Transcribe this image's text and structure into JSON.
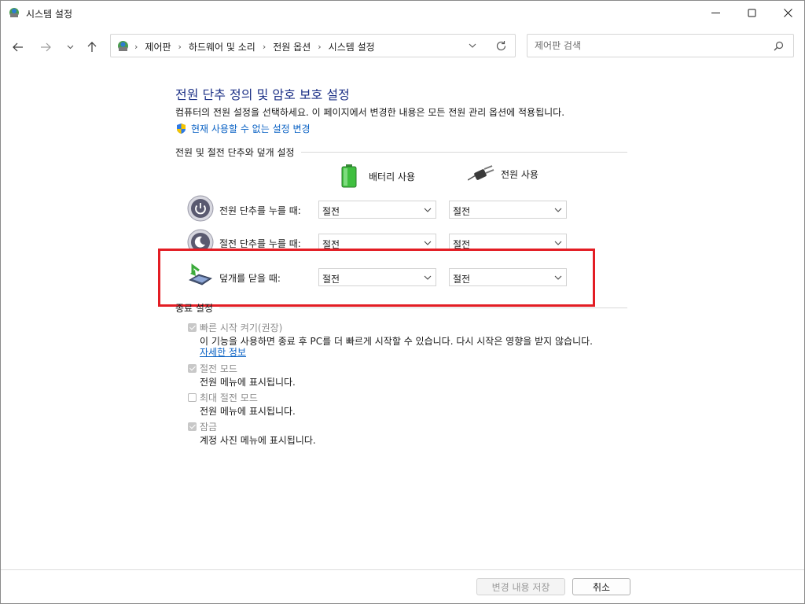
{
  "window": {
    "title": "시스템 설정"
  },
  "address": {
    "crumbs": [
      "제어판",
      "하드웨어 및 소리",
      "전원 옵션",
      "시스템 설정"
    ]
  },
  "search": {
    "placeholder": "제어판 검색"
  },
  "content": {
    "title": "전원 단추 정의 및 암호 보호 설정",
    "description": "컴퓨터의 전원 설정을 선택하세요. 이 페이지에서 변경한 내용은 모든 전원 관리 옵션에 적용됩니다.",
    "change_link": "현재 사용할 수 없는 설정 변경",
    "power_section": {
      "heading": "전원 및 절전 단추와 덮개 설정",
      "col_battery": "배터리 사용",
      "col_plugged": "전원 사용",
      "rows": [
        {
          "label": "전원 단추를 누를 때:",
          "battery": "절전",
          "plugged": "절전"
        },
        {
          "label": "절전 단추를 누를 때:",
          "battery": "절전",
          "plugged": "절전"
        },
        {
          "label": "덮개를 닫을 때:",
          "battery": "절전",
          "plugged": "절전"
        }
      ]
    },
    "shutdown_section": {
      "heading": "종료 설정",
      "items": [
        {
          "label": "빠른 시작 켜기(권장)",
          "checked": true,
          "desc": "이 기능을 사용하면 종료 후 PC를 더 빠르게 시작할 수 있습니다. 다시 시작은 영향을 받지 않습니다."
        },
        {
          "label": "절전 모드",
          "checked": true,
          "desc": "전원 메뉴에 표시됩니다."
        },
        {
          "label": "최대 절전 모드",
          "checked": false,
          "desc": "전원 메뉴에 표시됩니다."
        },
        {
          "label": "잠금",
          "checked": true,
          "desc": "계정 사진 메뉴에 표시됩니다."
        }
      ],
      "more_link": "자세한 정보"
    }
  },
  "footer": {
    "save": "변경 내용 저장",
    "cancel": "취소"
  },
  "colors": {
    "title": "#1e3287",
    "link": "#0a62c4",
    "highlight": "#e31d24"
  }
}
